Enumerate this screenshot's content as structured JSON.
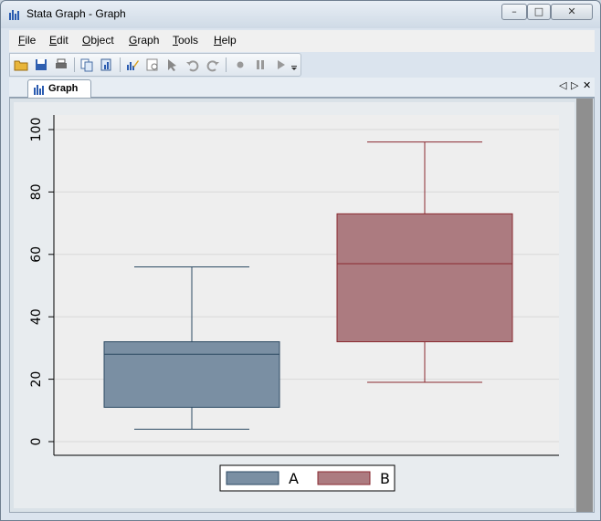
{
  "window": {
    "title": "Stata Graph - Graph",
    "controls": {
      "minimize": "–",
      "maximize": "□",
      "close": "✕"
    }
  },
  "menu": {
    "items": [
      {
        "key": "F",
        "rest": "ile"
      },
      {
        "key": "E",
        "rest": "dit"
      },
      {
        "key": "O",
        "rest": "bject"
      },
      {
        "key": "G",
        "rest": "raph"
      },
      {
        "key": "T",
        "rest": "ools"
      },
      {
        "key": "H",
        "rest": "elp"
      }
    ]
  },
  "toolbar": {
    "icons": [
      "open-folder-icon",
      "save-icon",
      "print-icon",
      "copy-icon",
      "copy-graph-icon",
      "graph-editor-icon",
      "preview-icon",
      "pointer-icon",
      "undo-icon",
      "redo-icon",
      "record-icon",
      "pause-icon",
      "play-icon",
      "overflow-icon"
    ]
  },
  "tabs": [
    {
      "label": "Graph",
      "active": true
    }
  ],
  "tab_controls": {
    "prev": "◁",
    "next": "▷",
    "close": "✕"
  },
  "colors": {
    "series_a": "#7a8fa3",
    "series_a_line": "#2c4a63",
    "series_b": "#ac7b80",
    "series_b_line": "#8a2a30",
    "plot_bg": "#eeeeee"
  },
  "chart_data": {
    "type": "box",
    "xlabel": "",
    "ylabel": "",
    "ylim": [
      0,
      100
    ],
    "yticks": [
      0,
      20,
      40,
      60,
      80,
      100
    ],
    "grid": true,
    "legend_position": "bottom",
    "series": [
      {
        "name": "A",
        "whisker_low": 4,
        "q1": 11,
        "median": 28,
        "q3": 32,
        "whisker_high": 56
      },
      {
        "name": "B",
        "whisker_low": 19,
        "q1": 32,
        "median": 57,
        "q3": 73,
        "whisker_high": 96
      }
    ]
  }
}
